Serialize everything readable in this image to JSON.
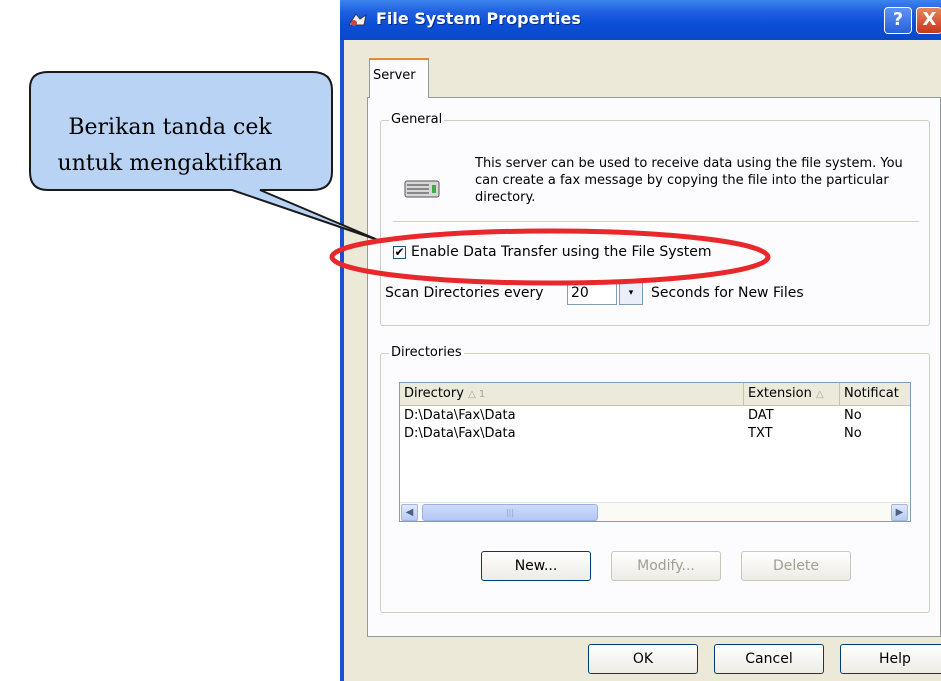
{
  "callout": {
    "line1": "Berikan tanda cek",
    "line2": "untuk mengaktifkan"
  },
  "window": {
    "title": "File System Properties",
    "help_glyph": "?",
    "close_glyph": "X"
  },
  "tabs": [
    {
      "label": "Server"
    }
  ],
  "general": {
    "label": "General",
    "description": "This server can be used to receive data using the file system. You can create a fax message by copying the file into the particular directory.",
    "enable_label": "Enable Data Transfer using the File System",
    "enable_checked": true,
    "scan_before": "Scan Directories every",
    "scan_value": "20",
    "scan_after": "Seconds for New Files"
  },
  "directories": {
    "label": "Directories",
    "columns": [
      "Directory",
      "Extension",
      "Notificat"
    ],
    "sort_indicators": [
      "△ 1",
      "△"
    ],
    "rows": [
      [
        "D:\\Data\\Fax\\Data",
        "DAT",
        "No"
      ],
      [
        "D:\\Data\\Fax\\Data",
        "TXT",
        "No"
      ]
    ],
    "buttons": {
      "new": "New...",
      "modify": "Modify...",
      "delete": "Delete"
    }
  },
  "dialog_buttons": {
    "ok": "OK",
    "cancel": "Cancel",
    "help": "Help"
  },
  "colors": {
    "callout_fill": "#b9d3f5",
    "highlight_ellipse": "#e8282b",
    "titlebar": "#0b4fd8"
  }
}
